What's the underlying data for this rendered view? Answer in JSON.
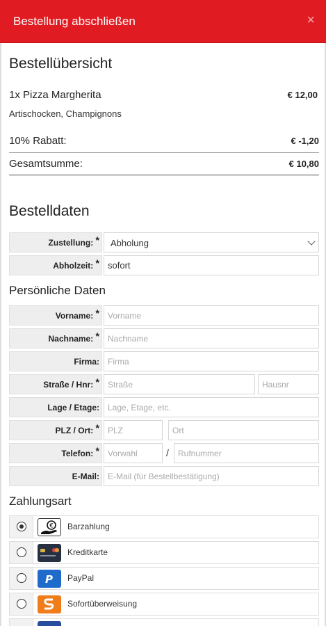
{
  "header": {
    "title": "Bestellung abschließen",
    "close": "×"
  },
  "overview": {
    "heading": "Bestellübersicht",
    "item": {
      "name": "1x Pizza Margherita",
      "price": "€ 12,00",
      "extras": "Artischocken, Champignons"
    },
    "discount": {
      "label": "10% Rabatt:",
      "value": "€ -1,20"
    },
    "total": {
      "label": "Gesamtsumme:",
      "value": "€ 10,80"
    }
  },
  "order": {
    "heading": "Bestelldaten",
    "delivery": {
      "label": "Zustellung:",
      "value": "Abholung"
    },
    "pickup": {
      "label": "Abholzeit:",
      "value": "sofort"
    }
  },
  "personal": {
    "heading": "Persönliche Daten",
    "required": "*",
    "firstname": {
      "label": "Vorname:",
      "placeholder": "Vorname"
    },
    "lastname": {
      "label": "Nachname:",
      "placeholder": "Nachname"
    },
    "company": {
      "label": "Firma:",
      "placeholder": "Firma"
    },
    "street": {
      "label": "Straße / Hnr:",
      "placeholder": "Straße",
      "number_placeholder": "Hausnr"
    },
    "floor": {
      "label": "Lage / Etage:",
      "placeholder": "Lage, Etage, etc."
    },
    "zip": {
      "label": "PLZ / Ort:",
      "placeholder": "PLZ",
      "city_placeholder": "Ort"
    },
    "phone": {
      "label": "Telefon:",
      "placeholder": "Vorwahl",
      "separator": "/",
      "number_placeholder": "Rufnummer"
    },
    "email": {
      "label": "E-Mail:",
      "placeholder": "E-Mail (für Bestellbestätigung)"
    }
  },
  "payment": {
    "heading": "Zahlungsart",
    "methods": [
      {
        "label": "Barzahlung",
        "icon": "cash-hand-icon",
        "selected": true
      },
      {
        "label": "Kreditkarte",
        "icon": "credit-card-icon",
        "selected": false
      },
      {
        "label": "PayPal",
        "icon": "paypal-icon",
        "selected": false
      },
      {
        "label": "Sofortüberweisung",
        "icon": "sofort-icon",
        "selected": false
      }
    ]
  },
  "colors": {
    "header": "#e11b22",
    "paypal": "#1f6bcc",
    "sofort": "#f07d19"
  }
}
